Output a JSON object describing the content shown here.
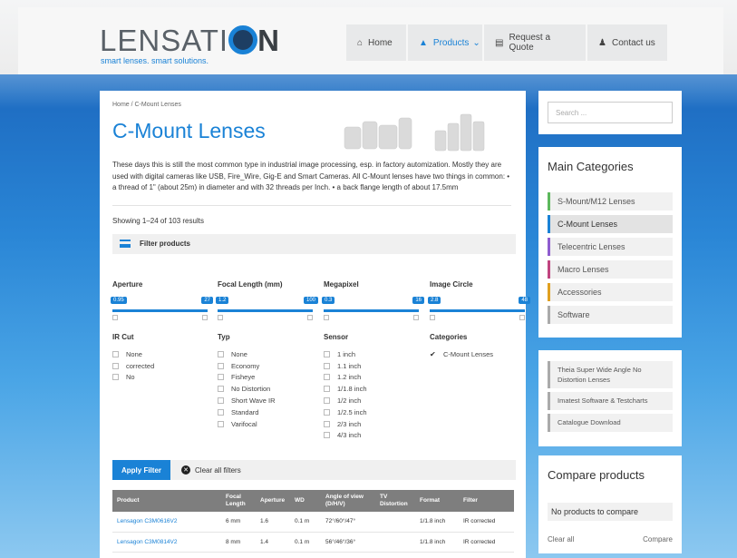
{
  "header": {
    "logo_main": "LENSATI",
    "logo_end": "N",
    "logo_tagline": "smart lenses. smart solutions.",
    "nav": [
      {
        "label": "Home",
        "icon": "home-icon"
      },
      {
        "label": "Products",
        "icon": "products-icon"
      },
      {
        "label": "Request a Quote",
        "icon": "quote-icon"
      },
      {
        "label": "Contact us",
        "icon": "contact-icon"
      }
    ],
    "nav_dropdown_glyph": "⌄"
  },
  "main": {
    "breadcrumb": "Home / C-Mount Lenses",
    "title": "C-Mount Lenses",
    "description": "These days this is still the most common type in industrial image processing, esp. in factory automization. Mostly they are used with digital cameras like USB, Fire_Wire, Gig-E and Smart Cameras. All C-Mount lenses have two things in common: • a thread of 1\" (about 25m) in diameter and with 32 threads per Inch. • a back flange length of about 17.5mm",
    "showing": "Showing 1–24 of 103 results",
    "filter_label": "Filter products",
    "sliders": [
      {
        "label": "Aperture",
        "min": "0.95",
        "max": "27"
      },
      {
        "label": "Focal Length (mm)",
        "min": "1.2",
        "max": "100"
      },
      {
        "label": "Megapixel",
        "min": "0.3",
        "max": "16"
      },
      {
        "label": "Image Circle",
        "min": "2.8",
        "max": "48"
      }
    ],
    "check_groups": [
      {
        "label": "IR Cut",
        "items": [
          "None",
          "corrected",
          "No"
        ]
      },
      {
        "label": "Typ",
        "items": [
          "None",
          "Economy",
          "Fisheye",
          "No Distortion",
          "Short Wave IR",
          "Standard",
          "Varifocal"
        ]
      },
      {
        "label": "Sensor",
        "items": [
          "1 inch",
          "1.1 inch",
          "1.2 inch",
          "1/1.8 inch",
          "1/2 inch",
          "1/2.5 inch",
          "2/3 inch",
          "4/3 inch"
        ]
      },
      {
        "label": "Categories",
        "items": [
          "C-Mount Lenses"
        ]
      }
    ],
    "apply_label": "Apply Filter",
    "clear_label": "Clear all filters",
    "table": {
      "headers": [
        "Product",
        "Focal Length",
        "Aperture",
        "WD",
        "Angle of view (D/H/V)",
        "TV Distortion",
        "Format",
        "Filter"
      ],
      "rows": [
        [
          "Lensagon C3M0616V2",
          "6 mm",
          "1.6",
          "0.1 m",
          "72°/60°/47°",
          "",
          "1/1.8 inch",
          "IR corrected"
        ],
        [
          "Lensagon C3M0814V2",
          "8 mm",
          "1.4",
          "0.1 m",
          "56°/46°/36°",
          "",
          "1/1.8 inch",
          "IR corrected"
        ]
      ]
    }
  },
  "sidebar": {
    "search_placeholder": "Search ...",
    "categories_title": "Main Categories",
    "categories": [
      {
        "label": "S-Mount/M12 Lenses",
        "color": "#5cb85c"
      },
      {
        "label": "C-Mount Lenses",
        "color": "#1a82d6"
      },
      {
        "label": "Telecentric Lenses",
        "color": "#8e5ccf"
      },
      {
        "label": "Macro Lenses",
        "color": "#c0447f"
      },
      {
        "label": "Accessories",
        "color": "#e0a020"
      },
      {
        "label": "Software",
        "color": "#aaaaaa"
      }
    ],
    "links": [
      "Theia Super Wide Angle No Distortion Lenses",
      "Imatest Software & Testcharts",
      "Catalogue Download"
    ],
    "compare_title": "Compare products",
    "compare_empty": "No products to compare",
    "compare_clear": "Clear all",
    "compare_button": "Compare"
  },
  "colors": {
    "accent": "#1a82d6"
  }
}
